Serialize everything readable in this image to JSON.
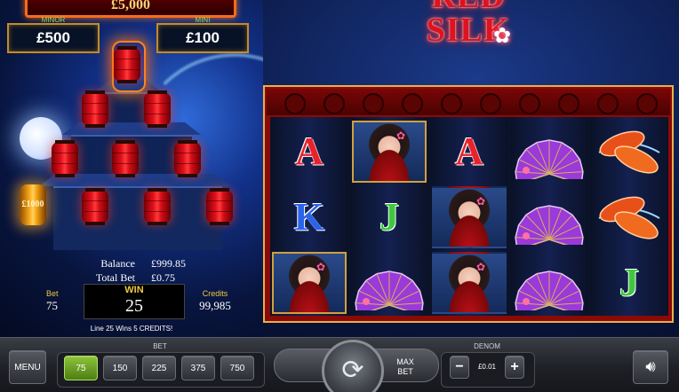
{
  "jackpots": {
    "top_value": "£5,000",
    "minor_label": "MINOR",
    "minor_value": "£500",
    "mini_label": "MINI",
    "mini_value": "£100"
  },
  "feature": {
    "prize_lantern": "£1000"
  },
  "logo": {
    "line1": "RED",
    "line2": "SILK"
  },
  "info": {
    "balance_label": "Balance",
    "balance_value": "£999.85",
    "total_bet_label": "Total Bet",
    "total_bet_value": "£0.75"
  },
  "stats": {
    "bet_label": "Bet",
    "bet_value": "75",
    "win_label": "WIN",
    "win_value": "25",
    "credits_label": "Credits",
    "credits_value": "99,985"
  },
  "message": "Line 25 Wins 5 CREDITS!",
  "reels": [
    [
      "A",
      "K",
      "GEISHA"
    ],
    [
      "GEISHA",
      "J",
      "FAN"
    ],
    [
      "A",
      "GEISHA",
      "GEISHA"
    ],
    [
      "FAN",
      "FAN",
      "FAN"
    ],
    [
      "KOI",
      "KOI",
      "J"
    ]
  ],
  "controls": {
    "menu_label": "MENU",
    "bet_title": "BET",
    "bet_options": [
      "75",
      "150",
      "225",
      "375",
      "750"
    ],
    "selected_bet": "75",
    "max_bet_line1": "MAX",
    "max_bet_line2": "BET",
    "denom_title": "DENOM",
    "denom_minus": "−",
    "denom_plus": "+",
    "denom_value": "£0.01",
    "spin_icon": "spin-icon",
    "sound_icon": "speaker-icon"
  },
  "colors": {
    "accent_gold": "#f0c840",
    "frame_red": "#8a0a08",
    "selected_bet": "#8ec43a"
  }
}
